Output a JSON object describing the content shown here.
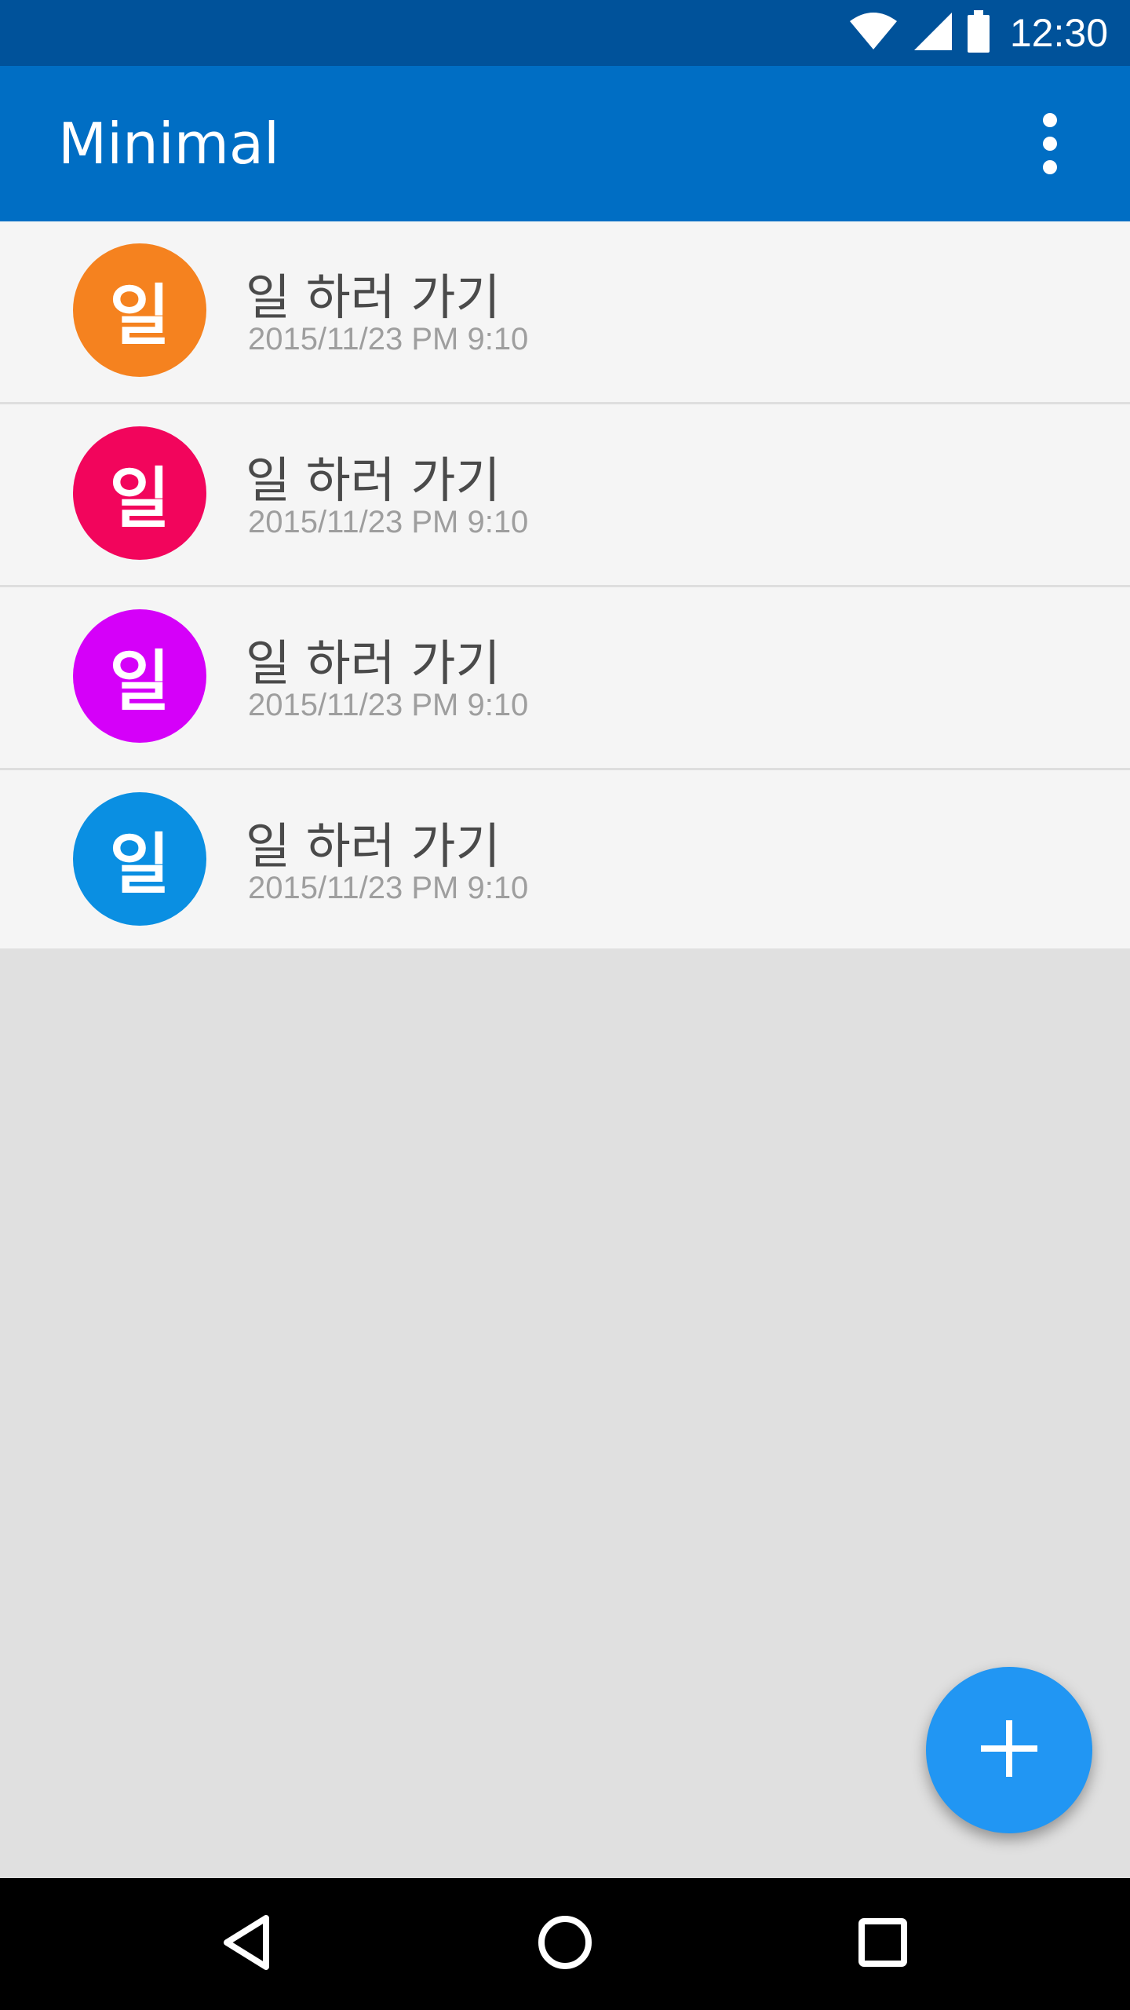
{
  "status_bar": {
    "time": "12:30",
    "icons": [
      "wifi-icon",
      "cellular-signal-icon",
      "battery-icon"
    ]
  },
  "app_bar": {
    "title": "Minimal",
    "menu_icon": "more-vert-icon"
  },
  "tasks": [
    {
      "initial": "일",
      "title": "일 하러 가기",
      "date": "2015/11/23 PM 9:10",
      "color": "#f5821f"
    },
    {
      "initial": "일",
      "title": "일 하러 가기",
      "date": "2015/11/23 PM 9:10",
      "color": "#f2055c"
    },
    {
      "initial": "일",
      "title": "일 하러 가기",
      "date": "2015/11/23 PM 9:10",
      "color": "#d500f9"
    },
    {
      "initial": "일",
      "title": "일 하러 가기",
      "date": "2015/11/23 PM 9:10",
      "color": "#0a8fe2"
    }
  ],
  "fab": {
    "icon": "plus-icon",
    "color": "#2196f3"
  },
  "nav_bar": {
    "icons": [
      "back-icon",
      "home-icon",
      "recents-icon"
    ]
  },
  "colors": {
    "status_bar": "#00529a",
    "app_bar": "#006ec4",
    "list_background": "#f5f5f5",
    "empty_background": "#e0e0e0"
  }
}
